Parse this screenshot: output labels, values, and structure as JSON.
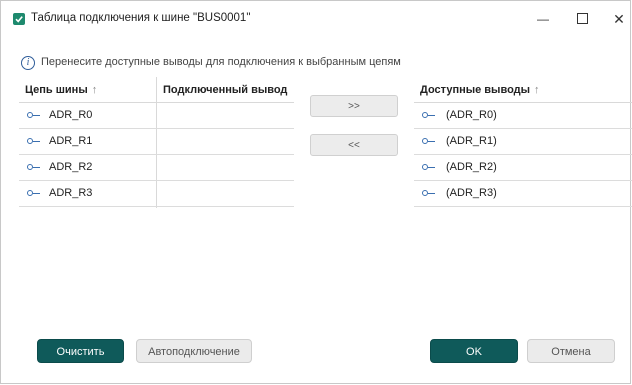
{
  "window": {
    "title": "Таблица подключения к шине \"BUS0001\"",
    "controls": {
      "minimize": "—",
      "close": "✕"
    }
  },
  "info": {
    "icon": "info-icon",
    "text": "Перенесите доступные выводы для подключения к выбранным цепям"
  },
  "left_table": {
    "headers": {
      "net": "Цепь шины",
      "net_sort": "↑",
      "pin": "Подключенный вывод"
    },
    "rows": [
      {
        "net": "ADR_R0",
        "pin": ""
      },
      {
        "net": "ADR_R1",
        "pin": ""
      },
      {
        "net": "ADR_R2",
        "pin": ""
      },
      {
        "net": "ADR_R3",
        "pin": ""
      }
    ]
  },
  "transfer": {
    "add": ">>",
    "remove": "<<"
  },
  "right_table": {
    "header": "Доступные выводы",
    "header_sort": "↑",
    "rows": [
      "(ADR_R0)",
      "(ADR_R1)",
      "(ADR_R2)",
      "(ADR_R3)"
    ]
  },
  "buttons": {
    "clear": "Очистить",
    "autoconnect": "Автоподключение",
    "ok": "OK",
    "cancel": "Отмена"
  },
  "colors": {
    "primary": "#0f5a5a",
    "accent_icon": "#1e8a6e",
    "pin": "#3a6fb0"
  }
}
